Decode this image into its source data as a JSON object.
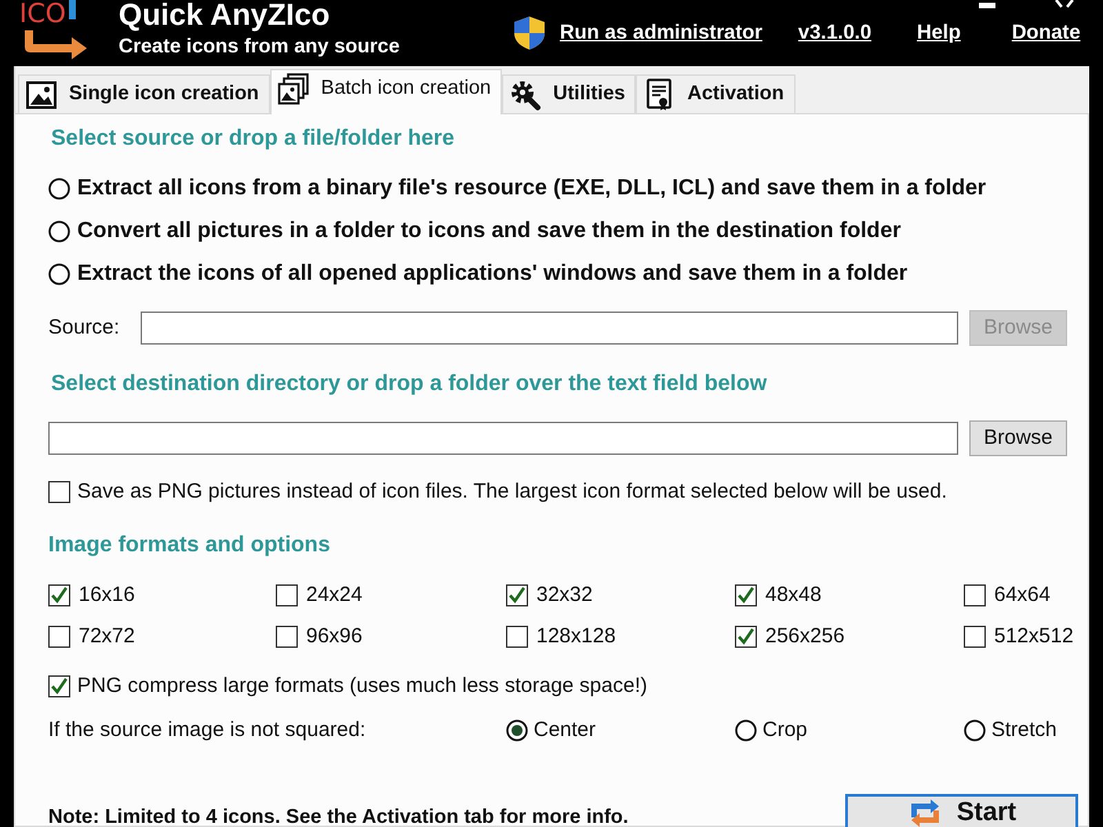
{
  "header": {
    "logo_text": "ICO",
    "title": "Quick AnyZIco",
    "subtitle": "Create icons from any source",
    "links": [
      {
        "kind": "elevated",
        "label": "Run as administrator"
      },
      {
        "kind": "plain",
        "label": "v3.1.0.0"
      },
      {
        "kind": "plain",
        "label": "Help"
      },
      {
        "kind": "plain",
        "label": "Donate"
      }
    ]
  },
  "tabs": [
    {
      "label": "Single icon creation",
      "selected": false
    },
    {
      "label": "Batch icon creation",
      "selected": true
    },
    {
      "label": "Utilities",
      "selected": false
    },
    {
      "label": "Activation",
      "selected": false
    }
  ],
  "source_section": {
    "heading": "Select source or drop a file/folder here",
    "options": [
      {
        "label": "Extract all icons from a binary file's resource (EXE, DLL, ICL) and save them in a folder",
        "selected": false
      },
      {
        "label": "Convert all pictures in a folder to icons and save them in the destination folder",
        "selected": false
      },
      {
        "label": "Extract the icons of all opened applications' windows and save them in a folder",
        "selected": false
      }
    ],
    "source_label": "Source:",
    "browse": {
      "label": "Browse",
      "disabled": true
    }
  },
  "destination_section": {
    "heading": "Select destination directory or drop a folder over the text field below",
    "browse": {
      "label": "Browse",
      "disabled": false
    },
    "save_png": {
      "label": "Save as PNG pictures instead of icon files. The largest icon format selected below will be used.",
      "checked": false
    }
  },
  "formats_section": {
    "heading": "Image formats and options",
    "formats": [
      {
        "label": "16x16",
        "checked": true
      },
      {
        "label": "24x24",
        "checked": false
      },
      {
        "label": "32x32",
        "checked": true
      },
      {
        "label": "48x48",
        "checked": true
      },
      {
        "label": "64x64",
        "checked": false
      },
      {
        "label": "72x72",
        "checked": false
      },
      {
        "label": "96x96",
        "checked": false
      },
      {
        "label": "128x128",
        "checked": false
      },
      {
        "label": "256x256",
        "checked": true
      },
      {
        "label": "512x512",
        "checked": false
      }
    ],
    "png_compress": {
      "label": "PNG compress large formats (uses much less storage space!)",
      "checked": true
    },
    "not_squared": {
      "label": "If the source image is not squared:",
      "options": [
        {
          "label": "Center",
          "selected": true
        },
        {
          "label": "Crop",
          "selected": false
        },
        {
          "label": "Stretch",
          "selected": false
        }
      ]
    }
  },
  "footer": {
    "note": "Note: Limited to 4 icons. See the Activation tab for more info.",
    "start_button": "Start"
  }
}
